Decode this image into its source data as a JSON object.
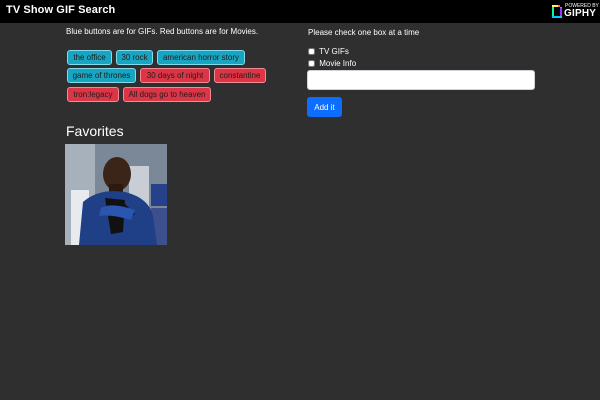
{
  "navbar": {
    "title": "TV Show GIF Search",
    "logo": {
      "small_text": "POWERED BY",
      "brand_text": "GIPHY",
      "icon": "giphy-logo-icon"
    }
  },
  "instructions": "Blue buttons are for GIFs. Red buttons are for Movies.",
  "buttons": [
    {
      "label": "the office",
      "type": "gif"
    },
    {
      "label": "30 rock",
      "type": "gif"
    },
    {
      "label": "american horror story",
      "type": "gif"
    },
    {
      "label": "game of thrones",
      "type": "gif"
    },
    {
      "label": "30 days of night",
      "type": "movie"
    },
    {
      "label": "constantine",
      "type": "movie"
    },
    {
      "label": "tron:legacy",
      "type": "movie"
    },
    {
      "label": "All dogs go to heaven",
      "type": "movie"
    }
  ],
  "favorites": {
    "title": "Favorites"
  },
  "form": {
    "label": "Please check one box at a time",
    "checkboxes": [
      {
        "label": "TV GIFs",
        "checked": false
      },
      {
        "label": "Movie Info",
        "checked": false
      }
    ],
    "input": {
      "value": "",
      "placeholder": ""
    },
    "add_button": "Add it"
  },
  "colors": {
    "background": "#2f2f2f",
    "navbar": "#000000",
    "gif_button": "#18a5c2",
    "movie_button": "#dc3545",
    "primary_button": "#0d6efd"
  }
}
